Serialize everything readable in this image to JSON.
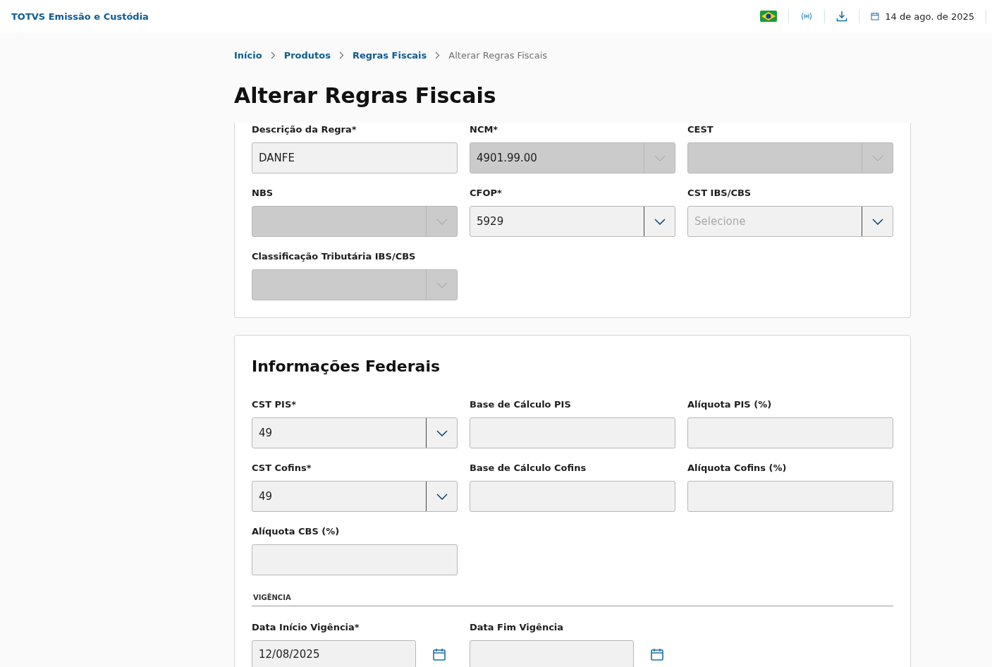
{
  "header": {
    "app_title": "TOTVS Emissão e Custódia",
    "date": "14 de ago. de 2025"
  },
  "breadcrumb": [
    {
      "label": "Início",
      "current": false
    },
    {
      "label": "Produtos",
      "current": false
    },
    {
      "label": "Regras Fiscais",
      "current": false
    },
    {
      "label": "Alterar Regras Fiscais",
      "current": true
    }
  ],
  "page_title": "Alterar Regras Fiscais",
  "rule_card": {
    "fields": [
      {
        "label": "Descrição da Regra*",
        "kind": "text",
        "value": "DANFE",
        "disabled": false
      },
      {
        "label": "NCM*",
        "kind": "select",
        "value": "4901.99.00",
        "disabled": true
      },
      {
        "label": "CEST",
        "kind": "select",
        "disabled": true
      },
      {
        "label": "NBS",
        "kind": "select",
        "disabled": true
      },
      {
        "label": "CFOP*",
        "kind": "select",
        "value": "5929",
        "disabled": false
      },
      {
        "label": "CST IBS/CBS",
        "kind": "select",
        "placeholder": "Selecione",
        "disabled": false
      },
      {
        "label": "Classificação Tributária IBS/CBS",
        "kind": "select",
        "disabled": true
      }
    ]
  },
  "federal_card": {
    "title": "Informações Federais",
    "fields": [
      {
        "label": "CST PIS*",
        "kind": "select",
        "value": "49",
        "disabled": false
      },
      {
        "label": "Base de Cálculo PIS",
        "kind": "text",
        "disabled": false
      },
      {
        "label": "Alíquota PIS (%)",
        "kind": "text",
        "disabled": false
      },
      {
        "label": "CST Cofins*",
        "kind": "select",
        "value": "49",
        "disabled": false
      },
      {
        "label": "Base de Cálculo Cofins",
        "kind": "text",
        "disabled": false
      },
      {
        "label": "Alíquota Cofins (%)",
        "kind": "text",
        "disabled": false
      },
      {
        "label": "Alíquota CBS (%)",
        "kind": "text",
        "disabled": false
      }
    ],
    "validity": {
      "heading": "VIGÊNCIA",
      "fields": [
        {
          "label": "Data Início Vigência*",
          "kind": "date",
          "value": "12/08/2025",
          "disabled": false
        },
        {
          "label": "Data Fim Vigência",
          "kind": "date",
          "disabled": false
        }
      ]
    }
  }
}
